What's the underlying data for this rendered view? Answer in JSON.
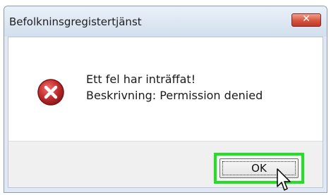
{
  "dialog": {
    "title": "Befolkninsgregistertjänst",
    "close_symbol": "✕",
    "icon": "error-icon",
    "message_line1": "Ett fel har inträffat!",
    "message_line2": "Beskrivning: Permission denied",
    "ok_label": "OK"
  },
  "colors": {
    "highlight": "#22e022",
    "error_red": "#c42d2d",
    "close_button": "#d5553e"
  }
}
